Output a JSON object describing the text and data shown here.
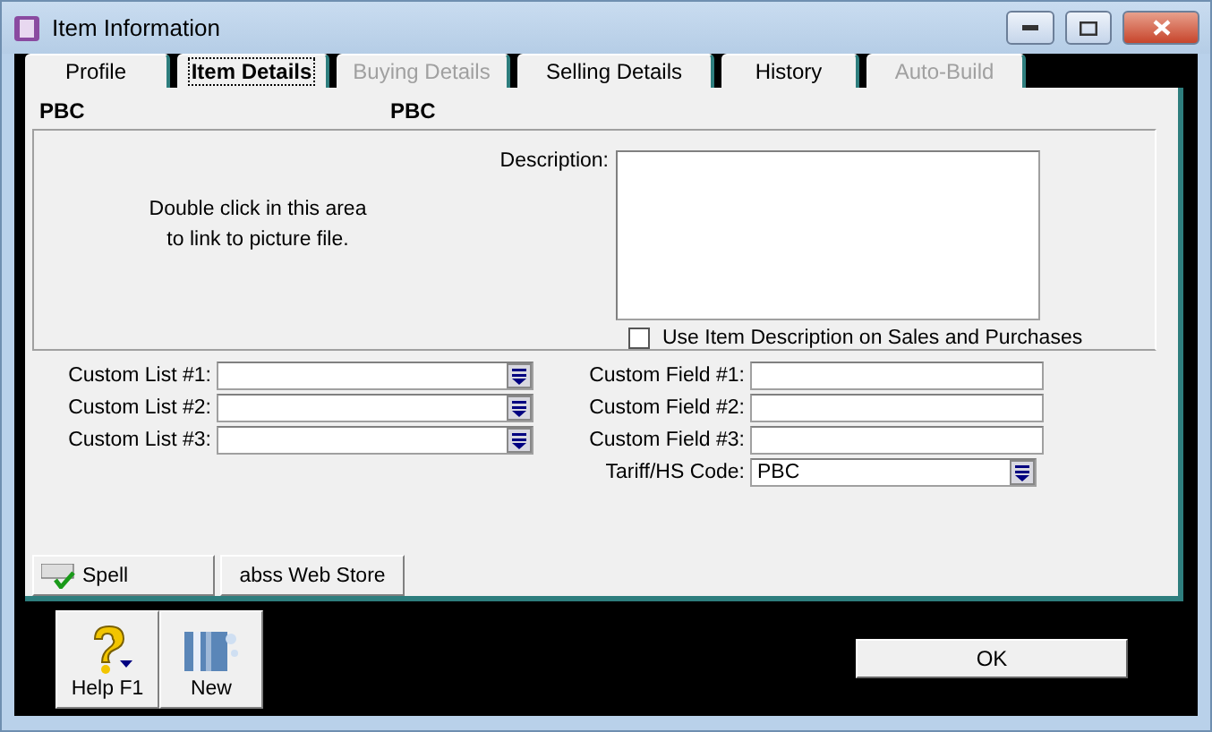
{
  "window": {
    "title": "Item Information"
  },
  "tabs": [
    {
      "label": "Profile",
      "selected": false,
      "disabled": false
    },
    {
      "label": "Item Details",
      "selected": true,
      "disabled": false
    },
    {
      "label": "Buying Details",
      "selected": false,
      "disabled": true
    },
    {
      "label": "Selling Details",
      "selected": false,
      "disabled": false
    },
    {
      "label": "History",
      "selected": false,
      "disabled": false
    },
    {
      "label": "Auto-Build",
      "selected": false,
      "disabled": true
    }
  ],
  "header": {
    "item_number": "PBC",
    "item_name": "PBC"
  },
  "picture_hint": "Double click in this area to link to picture file.",
  "description": {
    "label": "Description:",
    "checkbox": {
      "label": "Use Item Description on Sales and Purchases",
      "checked": false
    }
  },
  "custom_lists": [
    {
      "label": "Custom List #1:"
    },
    {
      "label": "Custom List #2:"
    },
    {
      "label": "Custom List #3:"
    }
  ],
  "custom_fields": [
    {
      "label": "Custom Field #1:",
      "kind": "text"
    },
    {
      "label": "Custom Field #2:",
      "kind": "text"
    },
    {
      "label": "Custom Field #3:",
      "kind": "text"
    },
    {
      "label": "Tariff/HS Code:",
      "kind": "dropdown",
      "value": "PBC"
    }
  ],
  "actions": [
    {
      "label": "Spell",
      "kind": "spell"
    },
    {
      "label": "abss Web Store",
      "kind": "plain"
    }
  ],
  "toolbar": [
    {
      "label": "Help F1",
      "kind": "help"
    },
    {
      "label": "New",
      "kind": "new"
    }
  ],
  "ok_button": "OK"
}
